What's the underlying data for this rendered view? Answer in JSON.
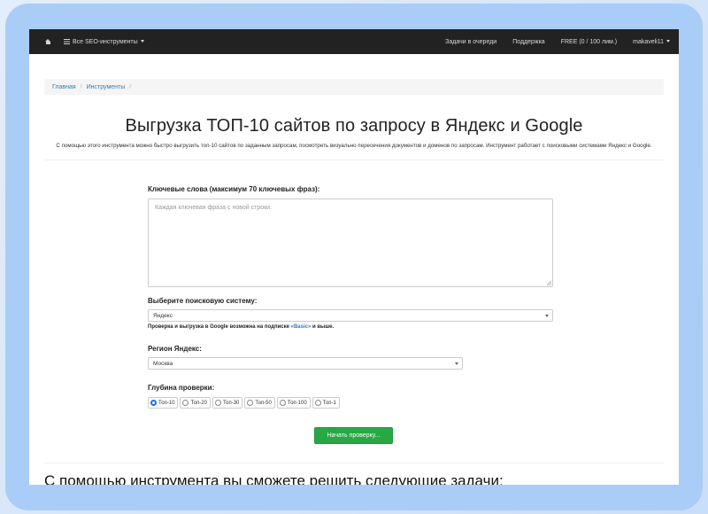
{
  "nav": {
    "home_icon": "home-icon",
    "tools_label": "Все SEO-инструменты",
    "queue_label": "Задачи в очереди",
    "support_label": "Поддержка",
    "plan_label": "FREE (0 / 100 лим.)",
    "user_label": "makaveli11"
  },
  "breadcrumb": {
    "home": "Главная",
    "tools": "Инструменты"
  },
  "page": {
    "title": "Выгрузка ТОП-10 сайтов по запросу в Яндекс и Google",
    "lead": "С помощью этого инструмента можно быстро выгрузить топ-10 сайтов по заданным запросам, посмотреть визуально пересечения документов и доменов по запросам. Инструмент работает с поисковыми системами Яндекс и Google."
  },
  "form": {
    "keywords_label": "Ключевые слова (максимум 70 ключевых фраз):",
    "keywords_placeholder": "Каждая ключевая фраза с новой строки.",
    "engine_label": "Выберите поисковую систему:",
    "engine_value": "Яндекс",
    "engine_help_prefix": "Проверка и выгрузка в Google возможна на подписке ",
    "engine_help_plan": "«Basic»",
    "engine_help_suffix": " и выше.",
    "region_label": "Регион Яндекс:",
    "region_value": "Москва",
    "depth_label": "Глубина проверки:",
    "depth_options": [
      "Топ-10",
      "Топ-20",
      "Топ-30",
      "Топ-50",
      "Топ-100",
      "Топ-1"
    ],
    "depth_selected": "Топ-10",
    "submit_label": "Начать проверку..."
  },
  "section": {
    "heading": "С помощью инструмента вы сможете решить следующие задачи:"
  },
  "colors": {
    "navbar": "#222222",
    "link": "#337ab7",
    "button": "#28a745",
    "frame": "#a9cdf6"
  }
}
